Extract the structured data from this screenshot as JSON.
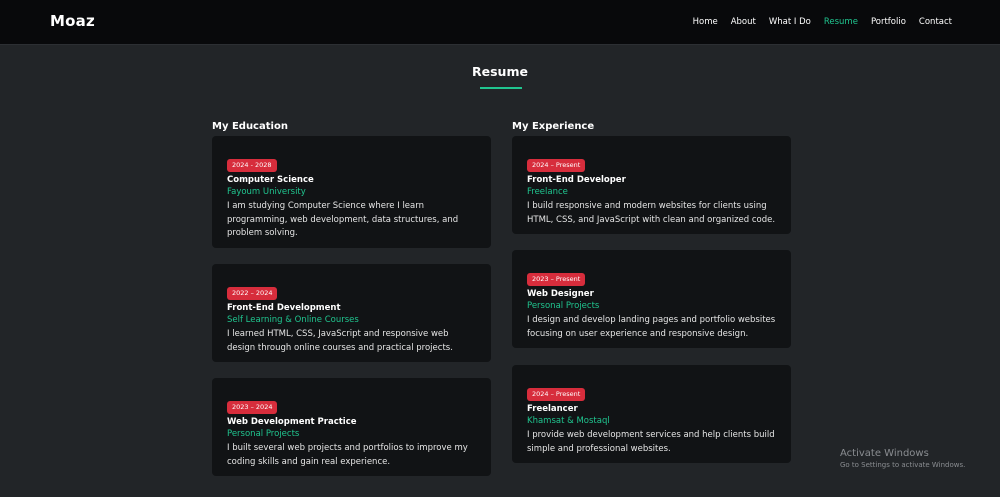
{
  "nav": {
    "logo": "Moaz",
    "links": [
      {
        "label": "Home",
        "active": false
      },
      {
        "label": "About",
        "active": false
      },
      {
        "label": "What I Do",
        "active": false
      },
      {
        "label": "Resume",
        "active": true
      },
      {
        "label": "Portfolio",
        "active": false
      },
      {
        "label": "Contact",
        "active": false
      }
    ]
  },
  "resume": {
    "title": "Resume",
    "education_heading": "My Education",
    "experience_heading": "My Experience",
    "education": [
      {
        "date": "2024 - 2028",
        "title": "Computer Science",
        "org": "Fayoum University",
        "description": "I am studying Computer Science where I learn programming, web development, data structures, and problem solving."
      },
      {
        "date": "2022 – 2024",
        "title": "Front-End Development",
        "org": "Self Learning & Online Courses",
        "description": "I learned HTML, CSS, JavaScript and responsive web design through online courses and practical projects."
      },
      {
        "date": "2023 – 2024",
        "title": "Web Development Practice",
        "org": "Personal Projects",
        "description": "I built several web projects and portfolios to improve my coding skills and gain real experience."
      }
    ],
    "experience": [
      {
        "date": "2024 – Present",
        "title": "Front-End Developer",
        "org": "Freelance",
        "description": "I build responsive and modern websites for clients using HTML, CSS, and JavaScript with clean and organized code."
      },
      {
        "date": "2023 – Present",
        "title": "Web Designer",
        "org": "Personal Projects",
        "description": "I design and develop landing pages and portfolio websites focusing on user experience and responsive design."
      },
      {
        "date": "2024 – Present",
        "title": "Freelancer",
        "org": "Khamsat & Mostaql",
        "description": "I provide web development services and help clients build simple and professional websites."
      }
    ]
  },
  "watermark": {
    "title": "Activate Windows",
    "subtitle": "Go to Settings to activate Windows."
  },
  "colors": {
    "accent": "#20c58f",
    "badge": "#d72d3c",
    "background": "#222528",
    "card": "#111315",
    "navbar": "#08090b"
  }
}
